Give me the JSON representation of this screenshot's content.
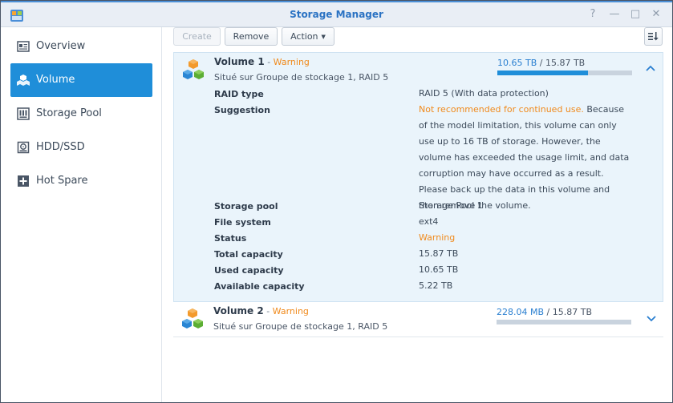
{
  "window": {
    "title": "Storage Manager",
    "controls": [
      "?",
      "—",
      "□",
      "✕"
    ]
  },
  "sidebar": {
    "items": [
      {
        "label": "Overview",
        "icon": "overview-icon",
        "active": false
      },
      {
        "label": "Volume",
        "icon": "volume-icon",
        "active": true
      },
      {
        "label": "Storage Pool",
        "icon": "storage-pool-icon",
        "active": false
      },
      {
        "label": "HDD/SSD",
        "icon": "hdd-icon",
        "active": false
      },
      {
        "label": "Hot Spare",
        "icon": "hot-spare-icon",
        "active": false
      }
    ]
  },
  "toolbar": {
    "create_label": "Create",
    "remove_label": "Remove",
    "action_label": "Action",
    "sort_icon": "sort-icon"
  },
  "volumes": [
    {
      "name": "Volume 1",
      "sep": " - ",
      "status": "Warning",
      "location": "Situé sur Groupe de stockage 1, RAID 5",
      "used": "10.65 TB",
      "slash": " / ",
      "total": "15.87 TB",
      "usage_fraction": 0.671,
      "expanded": true,
      "details": {
        "raid_type_label": "RAID type",
        "raid_type_value": "RAID 5 (With data protection)",
        "suggestion_label": "Suggestion",
        "suggestion_warning": "Not recommended for continued use.",
        "suggestion_text": " Because of the model limitation, this volume can only use up to 16 TB of storage. However, the volume has exceeded the usage limit, and data corruption may have occurred as a result. Please back up the data in this volume and then remove the volume.",
        "storage_pool_label": "Storage pool",
        "storage_pool_value": "Storage Pool 1",
        "file_system_label": "File system",
        "file_system_value": "ext4",
        "status_label": "Status",
        "status_value": "Warning",
        "total_capacity_label": "Total capacity",
        "total_capacity_value": "15.87 TB",
        "used_capacity_label": "Used capacity",
        "used_capacity_value": "10.65 TB",
        "available_capacity_label": "Available capacity",
        "available_capacity_value": "5.22 TB"
      }
    },
    {
      "name": "Volume 2",
      "sep": " - ",
      "status": "Warning",
      "location": "Situé sur Groupe de stockage 1, RAID 5",
      "used": "228.04 MB",
      "slash": " / ",
      "total": "15.87 TB",
      "usage_fraction": 0.0,
      "expanded": false
    }
  ],
  "colors": {
    "accent": "#1f8ed9",
    "warning": "#f08a1c",
    "title": "#2a72c3"
  }
}
